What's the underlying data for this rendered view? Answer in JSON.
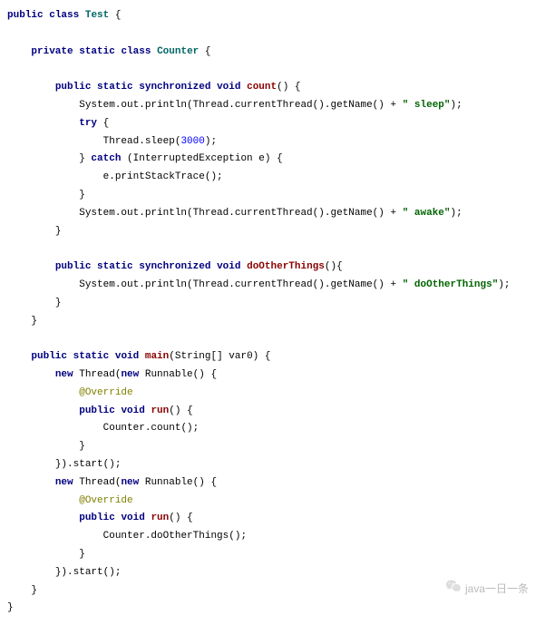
{
  "code": {
    "l1_kw1": "public",
    "l1_kw2": "class",
    "l1_cls": "Test",
    "l1_txt": " {",
    "l2_kw1": "private",
    "l2_kw2": "static",
    "l2_kw3": "class",
    "l2_cls": "Counter",
    "l2_txt": " {",
    "l3_kw1": "public",
    "l3_kw2": "static",
    "l3_kw3": "synchronized",
    "l3_kw4": "void",
    "l3_mth": "count",
    "l3_txt": "() {",
    "l4_a": "System.out.println(Thread.currentThread().getName() + ",
    "l4_str": "\" sleep\"",
    "l4_b": ");",
    "l5_kw": "try",
    "l5_txt": " {",
    "l6_a": "Thread.sleep(",
    "l6_num": "3000",
    "l6_b": ");",
    "l7_a": "} ",
    "l7_kw": "catch",
    "l7_b": " (InterruptedException e) {",
    "l8": "e.printStackTrace();",
    "l9": "}",
    "l10_a": "System.out.println(Thread.currentThread().getName() + ",
    "l10_str": "\" awake\"",
    "l10_b": ");",
    "l11": "}",
    "l12_kw1": "public",
    "l12_kw2": "static",
    "l12_kw3": "synchronized",
    "l12_kw4": "void",
    "l12_mth": "doOtherThings",
    "l12_txt": "(){",
    "l13_a": "System.out.println(Thread.currentThread().getName() + ",
    "l13_str": "\" doOtherThings\"",
    "l13_b": ");",
    "l14": "}",
    "l15": "}",
    "l16_kw1": "public",
    "l16_kw2": "static",
    "l16_kw3": "void",
    "l16_mth": "main",
    "l16_txt": "(String[] var0) {",
    "l17_kw1": "new",
    "l17_a": " Thread(",
    "l17_kw2": "new",
    "l17_b": " Runnable() {",
    "l18_ann": "@Override",
    "l19_kw1": "public",
    "l19_kw2": "void",
    "l19_mth": "run",
    "l19_txt": "() {",
    "l20": "Counter.count();",
    "l21": "}",
    "l22": "}).start();",
    "l23_kw1": "new",
    "l23_a": " Thread(",
    "l23_kw2": "new",
    "l23_b": " Runnable() {",
    "l24_ann": "@Override",
    "l25_kw1": "public",
    "l25_kw2": "void",
    "l25_mth": "run",
    "l25_txt": "() {",
    "l26": "Counter.doOtherThings();",
    "l27": "}",
    "l28": "}).start();",
    "l29": "}",
    "l30": "}"
  },
  "watermark": "java一日一条"
}
